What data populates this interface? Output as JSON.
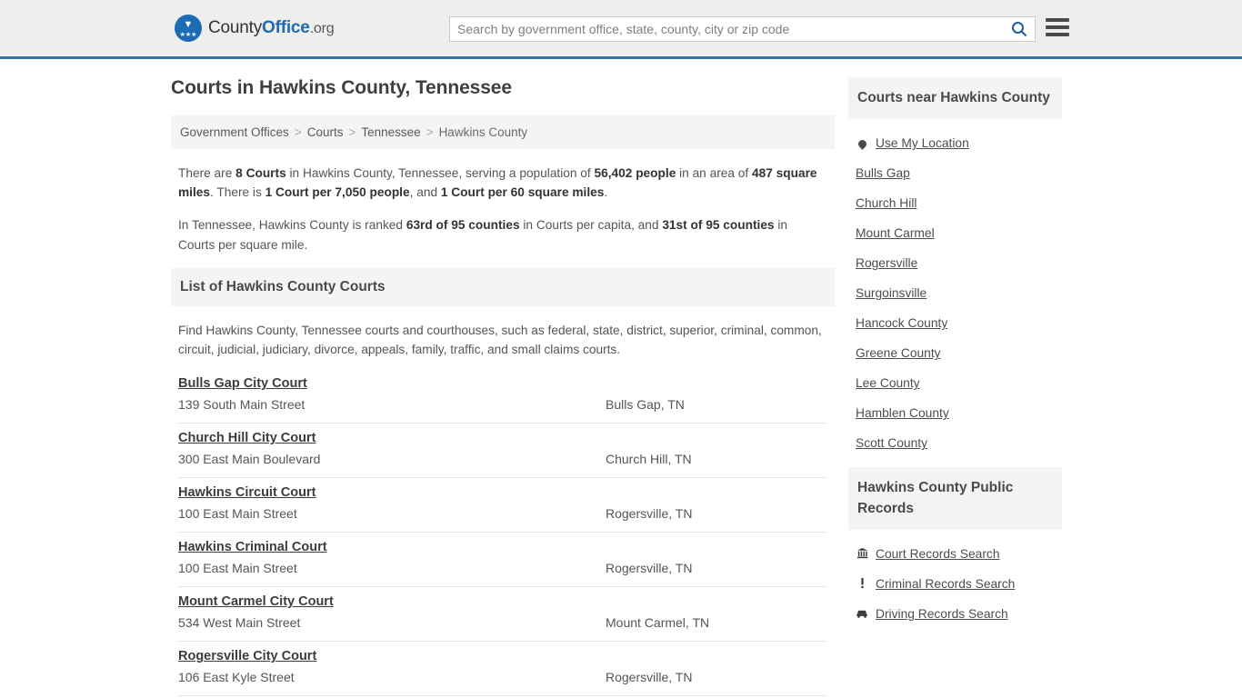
{
  "header": {
    "logo": {
      "part1": "County",
      "part2": "Office",
      "part3": ".org"
    },
    "search": {
      "placeholder": "Search by government office, state, county, city or zip code",
      "value": ""
    },
    "accent_color": "#3b72a4",
    "background_color": "#eeeeec"
  },
  "main": {
    "title": "Courts in Hawkins County, Tennessee",
    "breadcrumb": [
      {
        "label": "Government Offices",
        "current": false
      },
      {
        "label": "Courts",
        "current": false
      },
      {
        "label": "Tennessee",
        "current": false
      },
      {
        "label": "Hawkins County",
        "current": true
      }
    ],
    "stats": {
      "paragraph1_parts": [
        {
          "text": "There are ",
          "bold": false
        },
        {
          "text": "8 Courts",
          "bold": true
        },
        {
          "text": " in Hawkins County, Tennessee, serving a population of ",
          "bold": false
        },
        {
          "text": "56,402 people",
          "bold": true
        },
        {
          "text": " in an area of ",
          "bold": false
        },
        {
          "text": "487 square miles",
          "bold": true
        },
        {
          "text": ". There is ",
          "bold": false
        },
        {
          "text": "1 Court per 7,050 people",
          "bold": true
        },
        {
          "text": ", and ",
          "bold": false
        },
        {
          "text": "1 Court per 60 square miles",
          "bold": true
        },
        {
          "text": ".",
          "bold": false
        }
      ],
      "paragraph2_parts": [
        {
          "text": "In Tennessee, Hawkins County is ranked ",
          "bold": false
        },
        {
          "text": "63rd of 95 counties",
          "bold": true
        },
        {
          "text": " in Courts per capita, and ",
          "bold": false
        },
        {
          "text": "31st of 95 counties",
          "bold": true
        },
        {
          "text": " in Courts per square mile.",
          "bold": false
        }
      ],
      "court_count": 8,
      "population": "56,402",
      "area_sq_miles": 487,
      "courts_per_people": "1 Court per 7,050 people",
      "courts_per_area": "1 Court per 60 square miles",
      "rank_per_capita": "63rd of 95 counties",
      "rank_per_sq_mile": "31st of 95 counties"
    },
    "list_section": {
      "heading": "List of Hawkins County Courts",
      "description": "Find Hawkins County, Tennessee courts and courthouses, such as federal, state, district, superior, criminal, common, circuit, judicial, judiciary, divorce, appeals, family, traffic, and small claims courts."
    },
    "courts": [
      {
        "name": "Bulls Gap City Court",
        "address": "139 South Main Street",
        "city": "Bulls Gap, TN"
      },
      {
        "name": "Church Hill City Court",
        "address": "300 East Main Boulevard",
        "city": "Church Hill, TN"
      },
      {
        "name": "Hawkins Circuit Court",
        "address": "100 East Main Street",
        "city": "Rogersville, TN"
      },
      {
        "name": "Hawkins Criminal Court",
        "address": "100 East Main Street",
        "city": "Rogersville, TN"
      },
      {
        "name": "Mount Carmel City Court",
        "address": "534 West Main Street",
        "city": "Mount Carmel, TN"
      },
      {
        "name": "Rogersville City Court",
        "address": "106 East Kyle Street",
        "city": "Rogersville, TN"
      }
    ]
  },
  "sidebar": {
    "nearby": {
      "heading": "Courts near Hawkins County",
      "items": [
        {
          "label": "Use My Location",
          "icon": "map-pin-icon"
        },
        {
          "label": "Bulls Gap",
          "icon": ""
        },
        {
          "label": "Church Hill",
          "icon": ""
        },
        {
          "label": "Mount Carmel",
          "icon": ""
        },
        {
          "label": "Rogersville",
          "icon": ""
        },
        {
          "label": "Surgoinsville",
          "icon": ""
        },
        {
          "label": "Hancock County",
          "icon": ""
        },
        {
          "label": "Greene County",
          "icon": ""
        },
        {
          "label": "Lee County",
          "icon": ""
        },
        {
          "label": "Hamblen County",
          "icon": ""
        },
        {
          "label": "Scott County",
          "icon": ""
        }
      ]
    },
    "public_records": {
      "heading": "Hawkins County Public Records",
      "items": [
        {
          "label": "Court Records Search",
          "icon": "courthouse-icon",
          "glyph": "ἽB"
        },
        {
          "label": "Criminal Records Search",
          "icon": "exclamation-icon",
          "glyph": "!"
        },
        {
          "label": "Driving Records Search",
          "icon": "car-icon",
          "glyph": "⬜"
        }
      ]
    }
  }
}
